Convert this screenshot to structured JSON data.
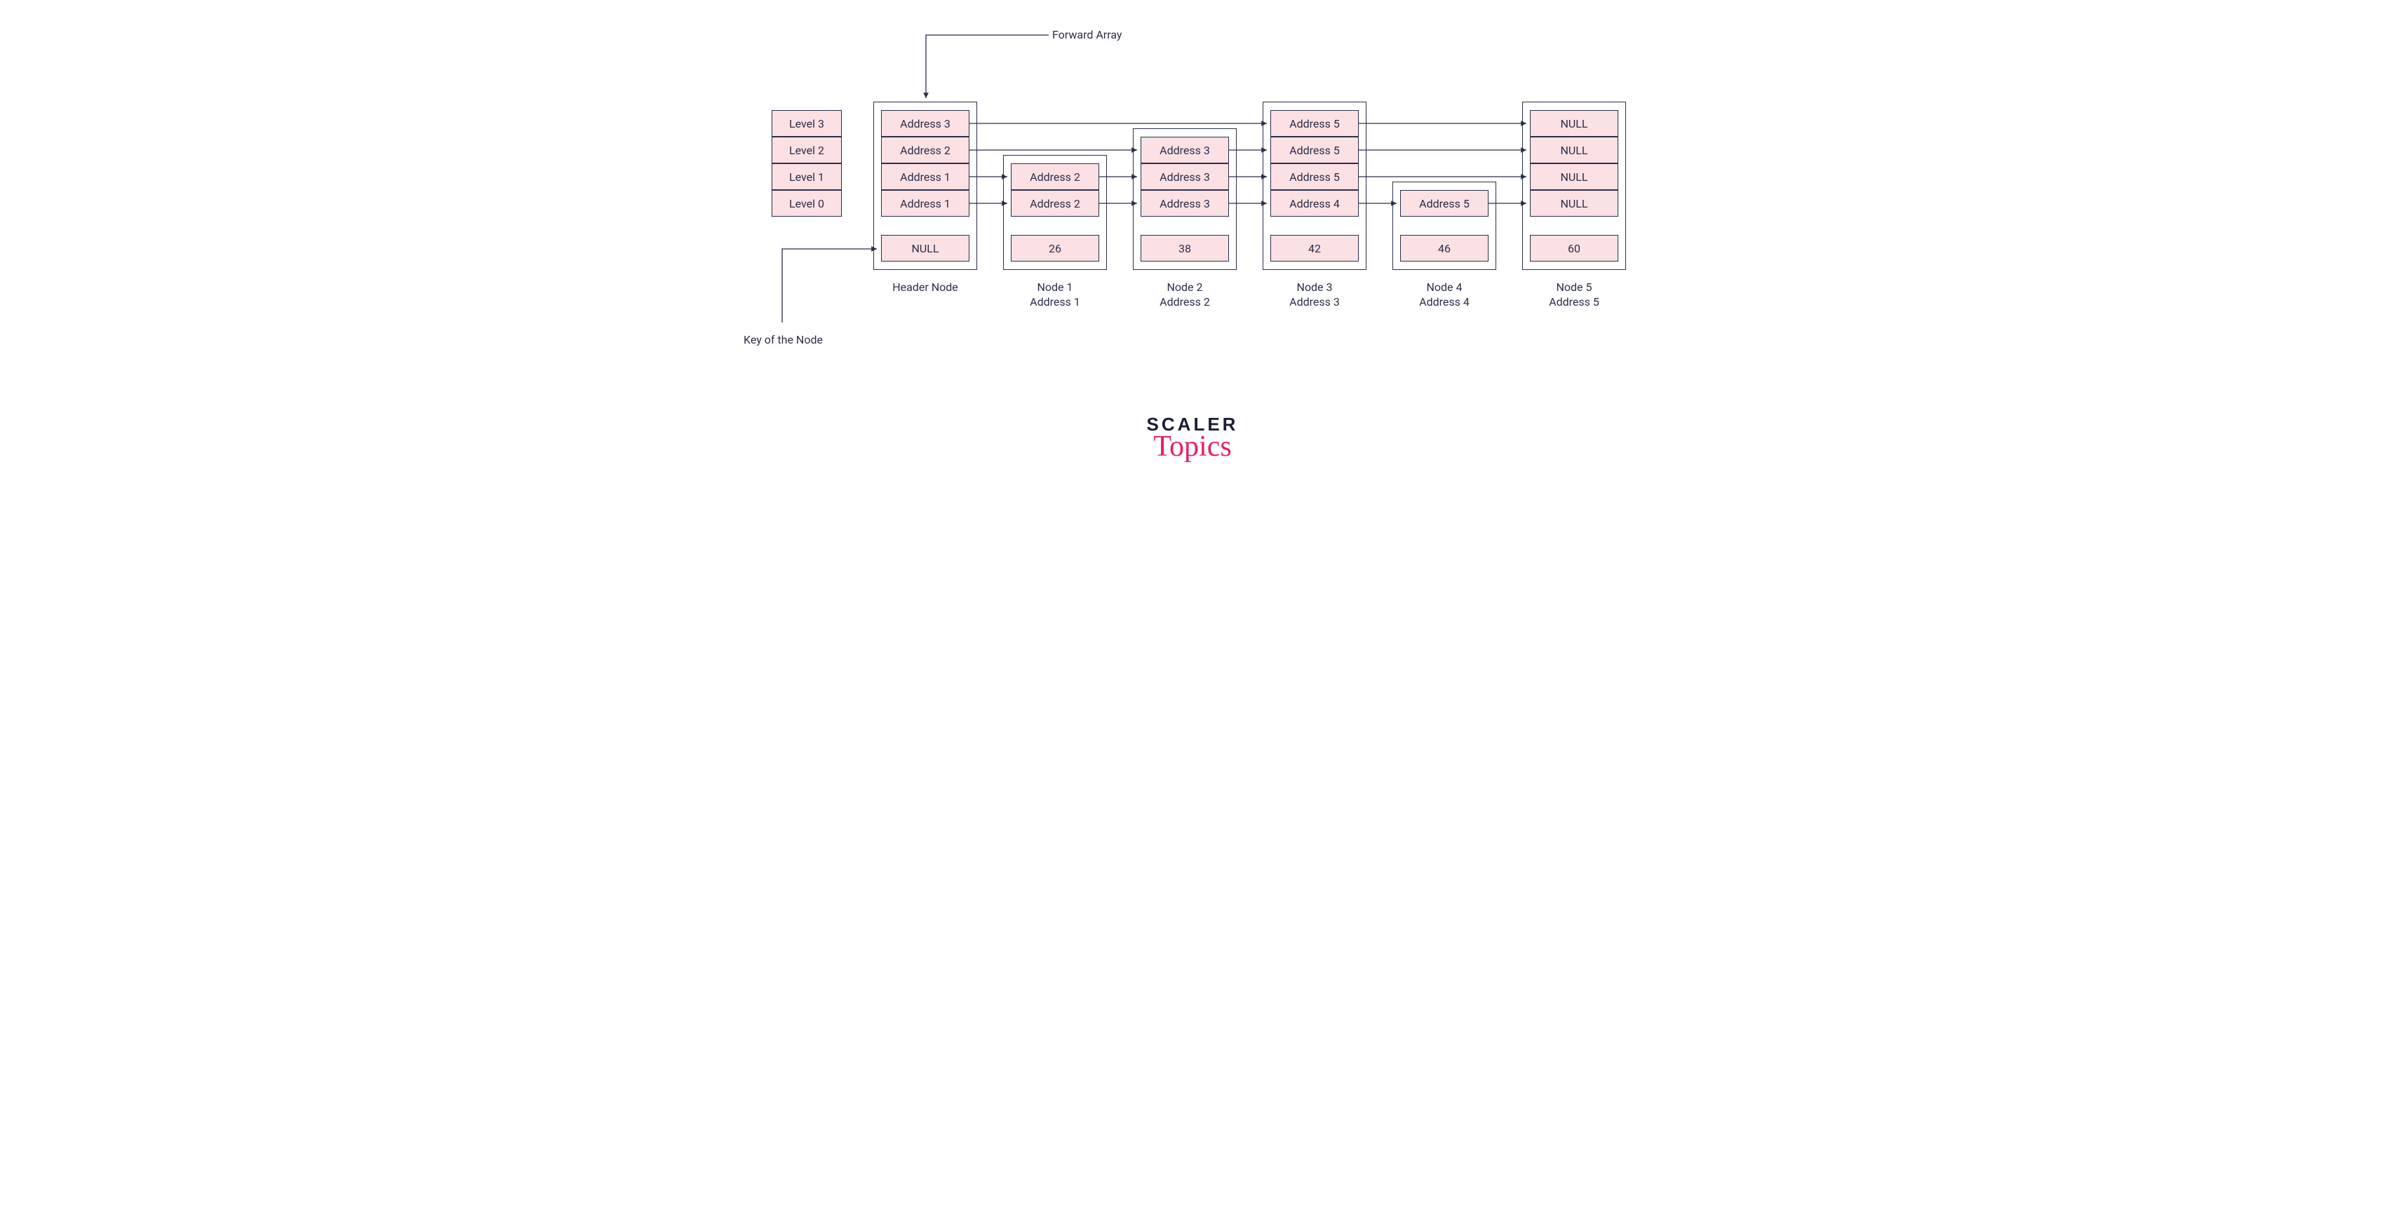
{
  "annotations": {
    "forward_array": "Forward Array",
    "key_of_node": "Key of the Node"
  },
  "levels": {
    "cells": [
      "Level 3",
      "Level 2",
      "Level 1",
      "Level 0"
    ]
  },
  "header": {
    "label": "Header Node",
    "forwards": [
      "Address 3",
      "Address 2",
      "Address 1",
      "Address 1"
    ],
    "key": "NULL"
  },
  "nodes": [
    {
      "name": "Node 1",
      "addr": "Address 1",
      "forwards": [
        "Address 2",
        "Address 2"
      ],
      "key": "26"
    },
    {
      "name": "Node 2",
      "addr": "Address 2",
      "forwards": [
        "Address 3",
        "Address 3",
        "Address 3"
      ],
      "key": "38"
    },
    {
      "name": "Node 3",
      "addr": "Address 3",
      "forwards": [
        "Address 5",
        "Address 5",
        "Address 5",
        "Address 4"
      ],
      "key": "42"
    },
    {
      "name": "Node 4",
      "addr": "Address 4",
      "forwards": [
        "Address 5"
      ],
      "key": "46"
    },
    {
      "name": "Node 5",
      "addr": "Address 5",
      "forwards": [
        "NULL",
        "NULL",
        "NULL",
        "NULL"
      ],
      "key": "60"
    }
  ],
  "logo": {
    "line1": "SCALER",
    "line2": "Topics"
  },
  "colors": {
    "border": "#2b2e4a",
    "fill": "#fce1e4",
    "accent": "#e91e63"
  }
}
